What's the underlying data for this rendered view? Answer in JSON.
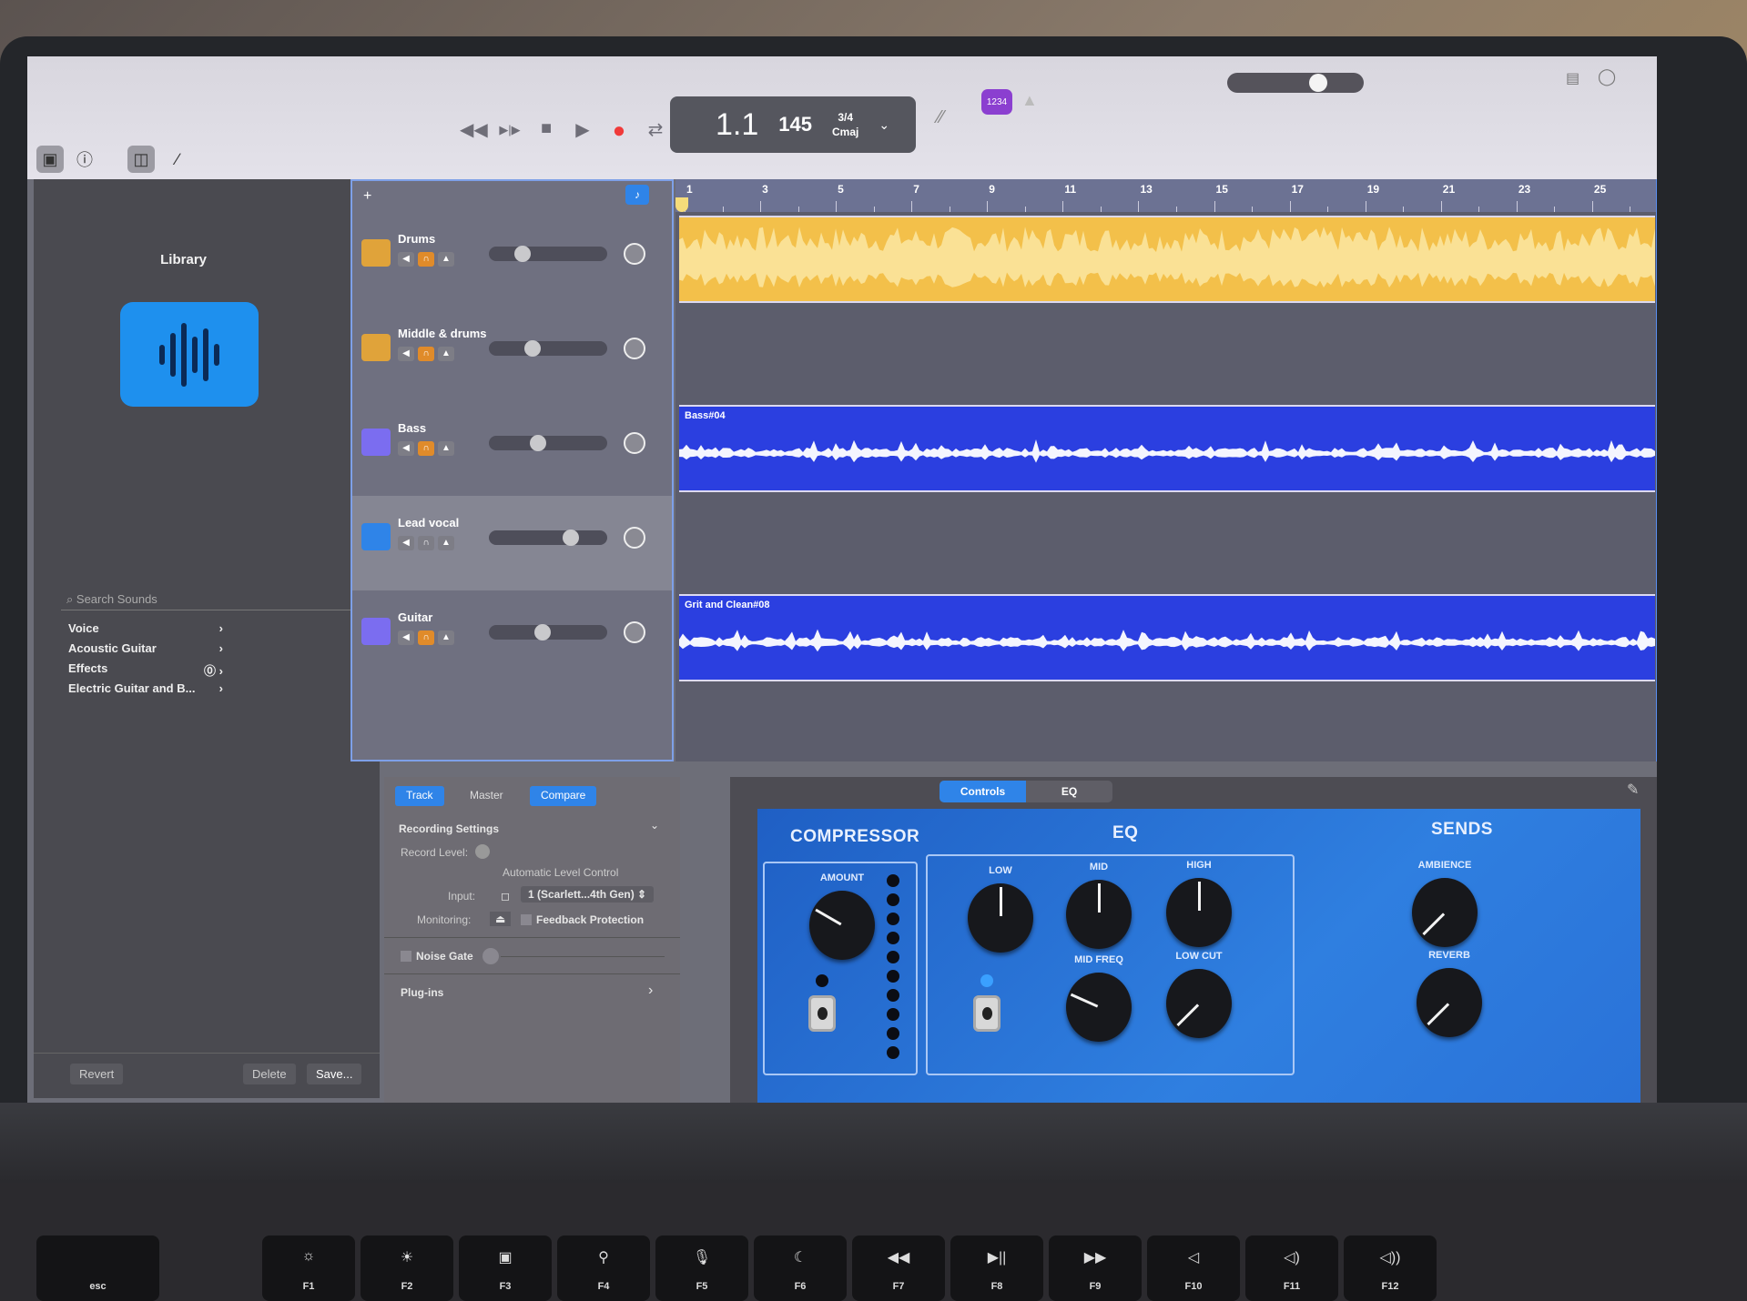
{
  "toolbar": {
    "icons": [
      "library-icon",
      "info-icon",
      "smart-controls-icon",
      "editor-icon"
    ],
    "transport": {
      "rewind": "◀◀",
      "forward": "▶|▶",
      "stop": "■",
      "play": "▶",
      "record": "●",
      "cycle": "⇄"
    },
    "lcd": {
      "position": "1.1",
      "tempo": "145",
      "time_signature": "3/4",
      "key": "Cmaj"
    },
    "count_in": "1234",
    "metronome": "▲",
    "master_volume": 0.7
  },
  "library": {
    "title": "Library",
    "search_placeholder": "Search Sounds",
    "items": [
      {
        "label": "Voice"
      },
      {
        "label": "Acoustic Guitar"
      },
      {
        "label": "Effects",
        "badge": "⓪"
      },
      {
        "label": "Electric Guitar and B..."
      }
    ],
    "buttons": {
      "revert": "Revert",
      "delete": "Delete",
      "save": "Save..."
    }
  },
  "tracks": [
    {
      "name": "Drums",
      "icon_color": "#e0a33a",
      "volume": 0.25,
      "selected": false
    },
    {
      "name": "Middle & drums",
      "icon_color": "#e0a33a",
      "volume": 0.35,
      "selected": false
    },
    {
      "name": "Bass",
      "icon_color": "#7b6df0",
      "volume": 0.4,
      "selected": false
    },
    {
      "name": "Lead vocal",
      "icon_color": "#2f84e8",
      "volume": 0.72,
      "selected": true
    },
    {
      "name": "Guitar",
      "icon_color": "#7b6df0",
      "volume": 0.45,
      "selected": false
    }
  ],
  "ruler": {
    "bars": [
      "1",
      "3",
      "5",
      "7",
      "9",
      "11",
      "13",
      "15",
      "17",
      "19",
      "21",
      "23",
      "25"
    ]
  },
  "regions": [
    {
      "track": 0,
      "label": "",
      "color": "#f3c04a"
    },
    {
      "track": 2,
      "label": "Bass#04",
      "color": "#2b3fe0"
    },
    {
      "track": 4,
      "label": "Grit and Clean#08",
      "color": "#2b3fe0"
    }
  ],
  "smart_controls": {
    "tabs": [
      "Track",
      "Master",
      "Compare"
    ],
    "recording_settings": "Recording Settings",
    "record_level": "Record Level:",
    "auto_level": "Automatic Level Control",
    "input_label": "Input:",
    "input_value": "1 (Scarlett...4th Gen)",
    "monitoring": "Monitoring:",
    "feedback": "Feedback Protection",
    "noise_gate": "Noise Gate",
    "plugins": "Plug-ins"
  },
  "plugin": {
    "tabs": [
      "Controls",
      "EQ"
    ],
    "compressor": {
      "title": "COMPRESSOR",
      "knobs": [
        {
          "label": "AMOUNT",
          "value": 0.3
        }
      ]
    },
    "eq": {
      "title": "EQ",
      "knobs": [
        {
          "label": "LOW",
          "value": 0.5
        },
        {
          "label": "MID",
          "value": 0.5
        },
        {
          "label": "HIGH",
          "value": 0.5
        },
        {
          "label": "MID FREQ",
          "value": 0.28
        },
        {
          "label": "LOW CUT",
          "value": 0.05
        }
      ]
    },
    "sends": {
      "title": "SENDS",
      "knobs": [
        {
          "label": "AMBIENCE",
          "value": 0.05
        },
        {
          "label": "REVERB",
          "value": 0.05
        }
      ]
    },
    "led_on_color": "#3aa0ff"
  },
  "keyboard": {
    "keys": [
      {
        "label": "esc",
        "glyph": ""
      },
      {
        "label": "F1",
        "glyph": "☼"
      },
      {
        "label": "F2",
        "glyph": "☀"
      },
      {
        "label": "F3",
        "glyph": "▣"
      },
      {
        "label": "F4",
        "glyph": "⚲"
      },
      {
        "label": "F5",
        "glyph": "🎙"
      },
      {
        "label": "F6",
        "glyph": "☾"
      },
      {
        "label": "F7",
        "glyph": "◀◀"
      },
      {
        "label": "F8",
        "glyph": "▶||"
      },
      {
        "label": "F9",
        "glyph": "▶▶"
      },
      {
        "label": "F10",
        "glyph": "◁"
      },
      {
        "label": "F11",
        "glyph": "◁)"
      },
      {
        "label": "F12",
        "glyph": "◁))"
      }
    ]
  }
}
